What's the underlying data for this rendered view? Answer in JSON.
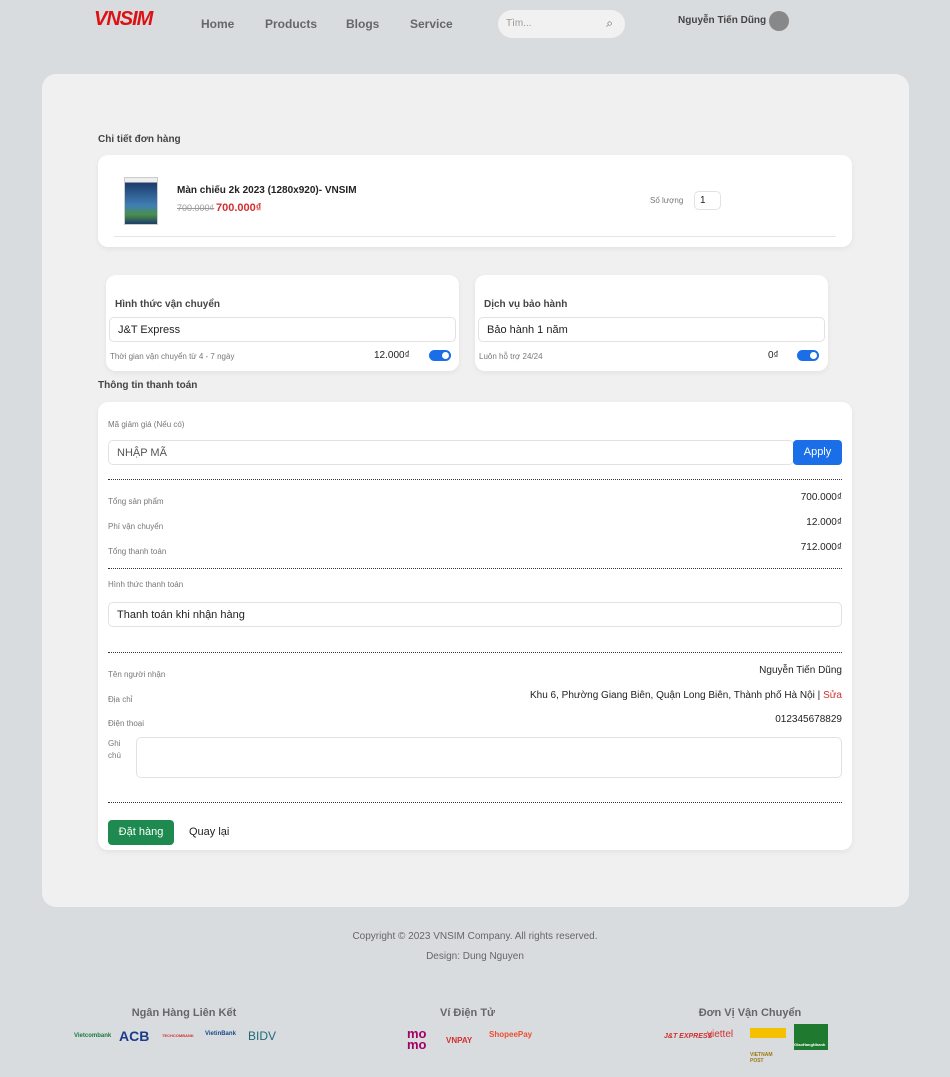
{
  "header": {
    "logo": "VNSIM",
    "nav": [
      "Home",
      "Products",
      "Blogs",
      "Service"
    ],
    "search_placeholder": "Tìm...",
    "user_name": "Nguyễn Tiến Dũng"
  },
  "order": {
    "title": "Chi tiết đơn hàng",
    "product_name": "Màn chiếu 2k 2023 (1280x920)- VNSIM",
    "old_price": "700.000₫",
    "price": "700.000₫",
    "qty_label": "Số lượng",
    "qty": "1"
  },
  "shipping": {
    "title": "Hình thức vận chuyển",
    "value": "J&T Express",
    "note": "Thời gian vận chuyển từ 4 - 7 ngày",
    "fee": "12.000₫",
    "enabled": true
  },
  "warranty": {
    "title": "Dịch vụ bảo hành",
    "value": "Bảo hành 1 năm",
    "note": "Luôn hỗ trợ 24/24",
    "fee": "0₫",
    "enabled": true
  },
  "payment": {
    "title": "Thông tin thanh toán",
    "coupon_label": "Mã giảm giá (Nếu có)",
    "coupon_placeholder": "NHẬP MÃ",
    "apply": "Apply",
    "subtotal_label": "Tổng sản phẩm",
    "subtotal": "700.000₫",
    "ship_label": "Phí vận chuyển",
    "ship": "12.000₫",
    "total_label": "Tổng thanh toán",
    "total": "712.000₫",
    "method_label": "Hình thức thanh toán",
    "method": "Thanh toán khi nhận hàng",
    "recipient_label": "Tên người nhận",
    "recipient": "Nguyễn Tiến Dũng",
    "address_label": "Địa chỉ",
    "address": "Khu 6, Phường Giang Biên, Quận Long Biên, Thành phố Hà Nội",
    "edit": "Sửa",
    "phone_label": "Điện thoại",
    "phone": "012345678829",
    "note_label": "Ghi chú",
    "submit": "Đặt hàng",
    "back": "Quay lại"
  },
  "footer": {
    "copyright": "Copyright © 2023 VNSIM Company. All rights reserved.",
    "design": "Design: Dung Nguyen",
    "banks_title": "Ngân Hàng Liên Kết",
    "banks": [
      "Vietcombank",
      "ACB",
      "TECHCOMBANK",
      "VietinBank",
      "BIDV"
    ],
    "wallets_title": "Ví Điện Tử",
    "wallets": [
      "momo",
      "VNPAY",
      "ShopeePay"
    ],
    "shipping_title": "Đơn Vị Vận Chuyển",
    "carriers": [
      "J&T EXPRESS",
      "viettel",
      "VIETNAM POST",
      "GiaoHangNhanh"
    ]
  },
  "colors": {
    "accent": "#1a6ee8",
    "price": "#d32f2f",
    "submit": "#1e8a4f",
    "background": "#d9dcdf"
  }
}
